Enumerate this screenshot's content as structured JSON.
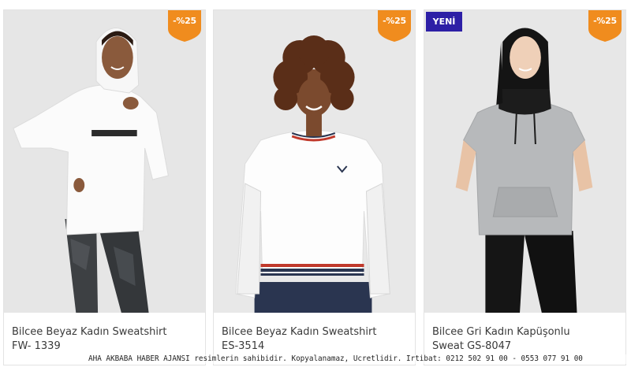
{
  "products": [
    {
      "title_line1": "Bilcee Beyaz Kadın Sweatshirt",
      "title_line2": "FW- 1339",
      "discount": "-%25",
      "badge": "",
      "image": "woman-white-hoodie-dark-leggings"
    },
    {
      "title_line1": "Bilcee Beyaz Kadın Sweatshirt",
      "title_line2": "ES-3514",
      "discount": "-%25",
      "badge": "",
      "image": "woman-white-sweatshirt-mesh-sleeves"
    },
    {
      "title_line1": "Bilcee Gri Kadın Kapüşonlu",
      "title_line2": "Sweat GS-8047",
      "discount": "-%25",
      "badge": "YENİ",
      "image": "woman-grey-short-sleeve-hoodie"
    }
  ],
  "watermark": "AHA AKBABA HABER AJANSI resimlerin sahibidir. Kopyalanamaz, Ucretlidir. Irtibat: 0212 502 91 00  - 0553 077 91 00",
  "colors": {
    "discount_badge": "#f08c1e",
    "new_badge": "#2d1fa6",
    "title_text": "#3a3a3a",
    "card_border": "#e3e3e3"
  },
  "icons": {
    "discount": "shield-badge-icon"
  }
}
